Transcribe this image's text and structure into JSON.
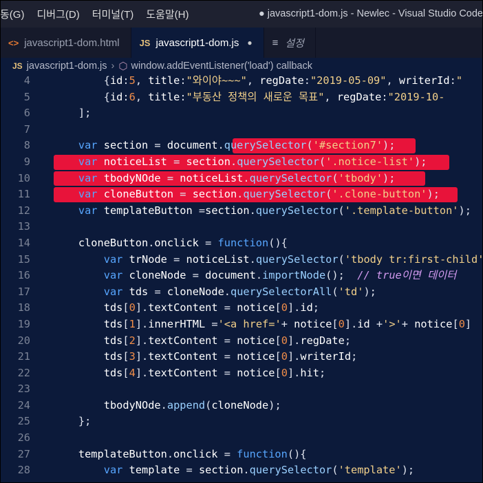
{
  "menu": [
    "동(G)",
    "디버그(D)",
    "터미널(T)",
    "도움말(H)"
  ],
  "window_title": "● javascript1-dom.js - Newlec - Visual Studio Code",
  "tabs": [
    {
      "label": "javascript1-dom.html",
      "icon": "html-file-icon",
      "active": false
    },
    {
      "label": "javascript1-dom.js",
      "icon": "js-file-icon",
      "active": true,
      "modified": true
    },
    {
      "label": "설정",
      "icon": "settings-list-icon",
      "active": false
    }
  ],
  "breadcrumb": {
    "file": "javascript1-dom.js",
    "symbol": "window.addEventListener('load') callback"
  },
  "highlight_color": "#e8133a",
  "code_lines": [
    {
      "n": "4",
      "text": "        {id:5, title:\"와이야~~~\", regDate:\"2019-05-09\", writerId:\""
    },
    {
      "n": "5",
      "text": "        {id:6, title:\"부동산 정책의 새로운 목표\", regDate:\"2019-10-"
    },
    {
      "n": "6",
      "text": "    ];"
    },
    {
      "n": "7",
      "text": ""
    },
    {
      "n": "8",
      "text": "    var section = document.querySelector('#section7');"
    },
    {
      "n": "9",
      "text": "    var noticeList = section.querySelector('.notice-list');"
    },
    {
      "n": "10",
      "text": "    var tbodyNOde = noticeList.querySelector('tbody');"
    },
    {
      "n": "11",
      "text": "    var cloneButton = section.querySelector('.clone-button');"
    },
    {
      "n": "12",
      "text": "    var templateButton =section.querySelector('.template-button');"
    },
    {
      "n": "13",
      "text": ""
    },
    {
      "n": "14",
      "text": "    cloneButton.onclick = function(){"
    },
    {
      "n": "15",
      "text": "        var trNode = noticeList.querySelector('tbody tr:first-child');"
    },
    {
      "n": "16",
      "text": "        var cloneNode = document.importNode();  // true이면 데이터"
    },
    {
      "n": "17",
      "text": "        var tds = cloneNode.querySelectorAll('td');"
    },
    {
      "n": "18",
      "text": "        tds[0].textContent = notice[0].id;"
    },
    {
      "n": "19",
      "text": "        tds[1].innerHTML ='<a href='+ notice[0].id +'>'+ notice[0]"
    },
    {
      "n": "20",
      "text": "        tds[2].textContent = notice[0].regDate;"
    },
    {
      "n": "21",
      "text": "        tds[3].textContent = notice[0].writerId;"
    },
    {
      "n": "22",
      "text": "        tds[4].textContent = notice[0].hit;"
    },
    {
      "n": "23",
      "text": ""
    },
    {
      "n": "24",
      "text": "        tbodyNOde.append(cloneNode);"
    },
    {
      "n": "25",
      "text": "    };"
    },
    {
      "n": "26",
      "text": ""
    },
    {
      "n": "27",
      "text": "    templateButton.onclick = function(){"
    },
    {
      "n": "28",
      "text": "        var template = section.querySelector('template');"
    }
  ]
}
